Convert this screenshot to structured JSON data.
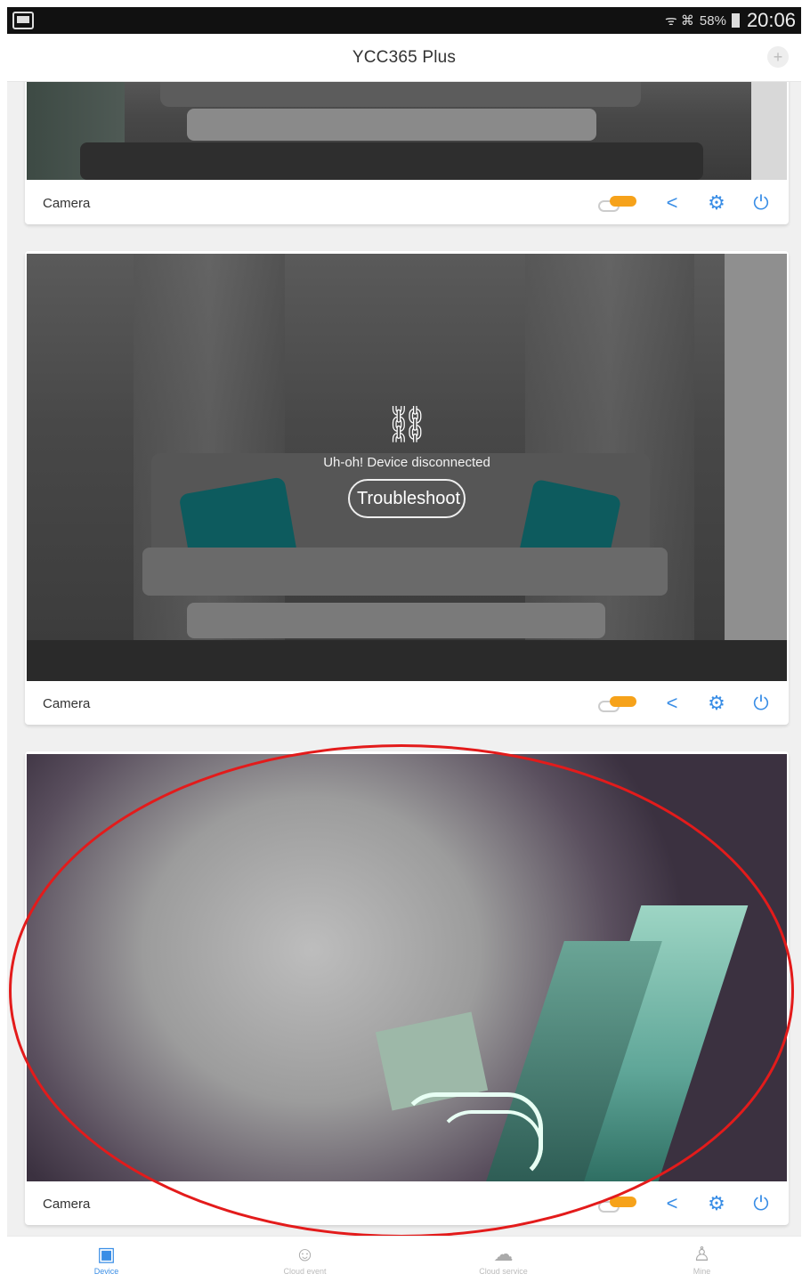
{
  "status_bar": {
    "battery": "58%",
    "time": "20:06",
    "signal_text": "ᯤ ⌘"
  },
  "header": {
    "title": "YCC365 Plus",
    "add_icon": "plus-icon"
  },
  "cards": [
    {
      "name": "Camera",
      "status": "online",
      "actions": [
        "cloud-icon",
        "share-icon",
        "settings-icon",
        "power-icon"
      ]
    },
    {
      "name": "Camera",
      "status": "disconnected",
      "message": "Uh-oh! Device disconnected",
      "button": "Troubleshoot",
      "actions": [
        "cloud-icon",
        "share-icon",
        "settings-icon",
        "power-icon"
      ]
    },
    {
      "name": "Camera",
      "status": "online",
      "actions": [
        "cloud-icon",
        "share-icon",
        "settings-icon",
        "power-icon"
      ]
    }
  ],
  "bottom_nav": [
    {
      "label": "Device",
      "icon": "device-icon",
      "active": true
    },
    {
      "label": "Cloud event",
      "icon": "face-icon",
      "active": false
    },
    {
      "label": "Cloud service",
      "icon": "cloud-icon",
      "active": false
    },
    {
      "label": "Mine",
      "icon": "user-icon",
      "active": false
    }
  ],
  "colors": {
    "accent": "#3a8ee6",
    "badge": "#f6a21a",
    "annotation": "#e31b1b"
  }
}
